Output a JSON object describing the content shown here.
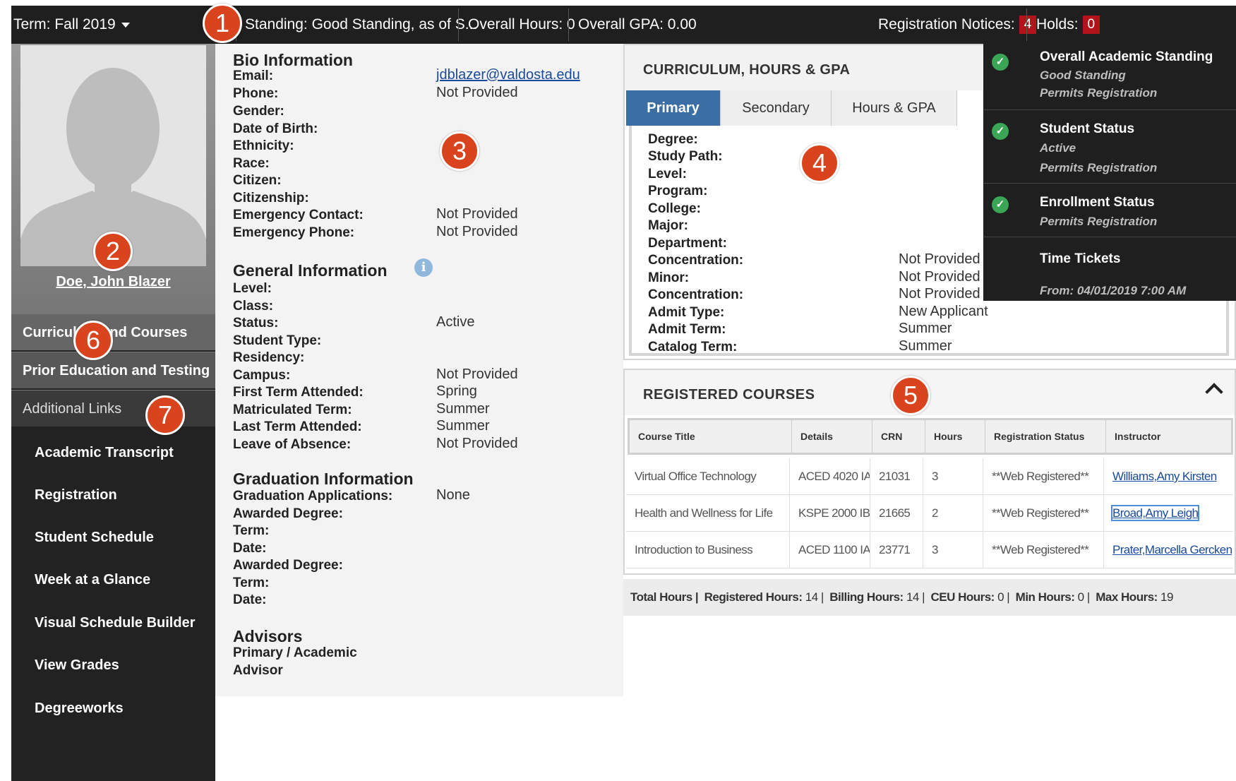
{
  "topbar": {
    "term": "Term: Fall 2019",
    "standing": "Standing: Good Standing, as of S...",
    "overall_hours": "Overall Hours: 0",
    "overall_gpa": "Overall GPA: 0.00",
    "registration_notices_label": "Registration Notices:",
    "registration_notices_count": "4",
    "holds_label": "Holds:",
    "holds_count": "0"
  },
  "sidebar": {
    "student_name": "Doe, John Blazer",
    "nav": [
      "Curriculum and Courses",
      "Prior Education and Testing",
      "Additional Links"
    ],
    "links": [
      "Academic Transcript",
      "Registration",
      "Student Schedule",
      "Week at a Glance",
      "Visual Schedule Builder",
      "View Grades",
      "Degreeworks"
    ]
  },
  "bio": {
    "heading": "Bio Information",
    "rows": [
      {
        "label": "Email:",
        "value": "jdblazer@valdosta.edu"
      },
      {
        "label": "Phone:",
        "value": "Not Provided"
      },
      {
        "label": "Gender:",
        "value": ""
      },
      {
        "label": "Date of Birth:",
        "value": ""
      },
      {
        "label": "Ethnicity:",
        "value": ""
      },
      {
        "label": "Race:",
        "value": ""
      },
      {
        "label": "Citizen:",
        "value": ""
      },
      {
        "label": "Citizenship:",
        "value": ""
      },
      {
        "label": "Emergency Contact:",
        "value": "Not Provided"
      },
      {
        "label": "Emergency Phone:",
        "value": "Not Provided"
      }
    ]
  },
  "general": {
    "heading": "General Information",
    "info_icon": "info-icon",
    "rows": [
      {
        "label": "Level:",
        "value": ""
      },
      {
        "label": "Class:",
        "value": ""
      },
      {
        "label": "Status:",
        "value": "Active"
      },
      {
        "label": "Student Type:",
        "value": ""
      },
      {
        "label": "Residency:",
        "value": ""
      },
      {
        "label": "Campus:",
        "value": "Not Provided"
      },
      {
        "label": "First Term Attended:",
        "value": "Spring"
      },
      {
        "label": "Matriculated Term:",
        "value": "Summer"
      },
      {
        "label": "Last Term Attended:",
        "value": "Summer"
      },
      {
        "label": "Leave of Absence:",
        "value": "Not Provided"
      }
    ]
  },
  "graduation": {
    "heading": "Graduation Information",
    "rows": [
      {
        "label": "Graduation Applications:",
        "value": "None"
      },
      {
        "label": "Awarded Degree:",
        "value": ""
      },
      {
        "label": "Term:",
        "value": ""
      },
      {
        "label": "Date:",
        "value": ""
      },
      {
        "label": "Awarded Degree:",
        "value": ""
      },
      {
        "label": "Term:",
        "value": ""
      },
      {
        "label": "Date:",
        "value": ""
      }
    ]
  },
  "advisors": {
    "heading": "Advisors",
    "line1": "Primary / Academic",
    "line2": "Advisor"
  },
  "curriculum": {
    "title": "CURRICULUM, HOURS & GPA",
    "tabs": [
      "Primary",
      "Secondary",
      "Hours & GPA"
    ],
    "rows": [
      {
        "label": "Degree:",
        "value": ""
      },
      {
        "label": "Study Path:",
        "value": ""
      },
      {
        "label": "Level:",
        "value": ""
      },
      {
        "label": "Program:",
        "value": ""
      },
      {
        "label": "College:",
        "value": ""
      },
      {
        "label": "Major:",
        "value": ""
      },
      {
        "label": "Department:",
        "value": ""
      },
      {
        "label": "Concentration:",
        "value": "Not Provided"
      },
      {
        "label": "Minor:",
        "value": "Not Provided"
      },
      {
        "label": "Concentration:",
        "value": "Not Provided"
      },
      {
        "label": "Admit Type:",
        "value": "New Applicant"
      },
      {
        "label": "Admit Term:",
        "value": "Summer"
      },
      {
        "label": "Catalog Term:",
        "value": "Summer"
      }
    ]
  },
  "notices": [
    {
      "title": "Overall Academic Standing",
      "lines": [
        "Good Standing",
        "Permits Registration"
      ],
      "icon": "check-icon"
    },
    {
      "title": "Student Status",
      "lines": [
        "Active",
        "Permits Registration"
      ],
      "icon": "check-icon"
    },
    {
      "title": "Enrollment Status",
      "lines": [
        "Permits Registration"
      ],
      "icon": "check-icon"
    },
    {
      "title": "Time Tickets",
      "lines": [
        "From: 04/01/2019 7:00 AM"
      ],
      "icon": ""
    }
  ],
  "registered": {
    "title": "REGISTERED COURSES",
    "columns": [
      "Course Title",
      "Details",
      "CRN",
      "Hours",
      "Registration Status",
      "Instructor"
    ],
    "rows": [
      [
        "Virtual Office Technology",
        "ACED 4020 IA",
        "21031",
        "3",
        "**Web Registered**",
        "Williams,Amy Kirsten"
      ],
      [
        "Health and Wellness for Life",
        "KSPE 2000 IB",
        "21665",
        "2",
        "**Web Registered**",
        "Broad,Amy Leigh"
      ],
      [
        "Introduction to Business",
        "ACED 1100 IA",
        "23771",
        "3",
        "**Web Registered**",
        "Prater,Marcella Gercken"
      ]
    ],
    "totals": {
      "total_hours_label": "Total Hours |",
      "registered_label": "Registered Hours:",
      "registered": "14",
      "billing_label": "Billing Hours:",
      "billing": "14",
      "ceu_label": "CEU Hours:",
      "ceu": "0",
      "min_label": "Min Hours:",
      "min": "0",
      "max_label": "Max Hours:",
      "max": "19"
    }
  },
  "callouts": [
    "1",
    "2",
    "3",
    "4",
    "5",
    "6",
    "7"
  ],
  "colors": {
    "accent": "#3a6ea5",
    "callout": "#d9441f",
    "badge": "#b3121b",
    "check": "#3aa655"
  }
}
